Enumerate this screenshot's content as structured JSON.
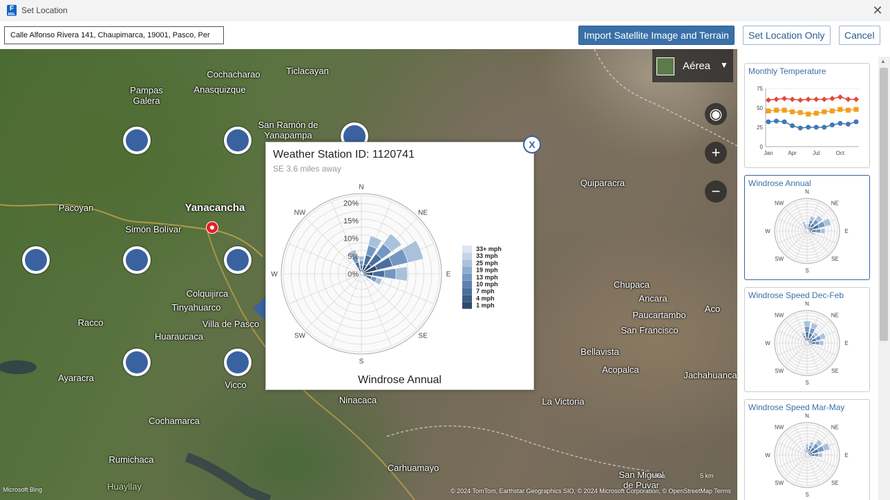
{
  "window": {
    "title": "Set Location",
    "app_icon_letter": "F",
    "app_icon_sub": "MSL",
    "close_symbol": "✕"
  },
  "toolbar": {
    "address_value": "Calle Alfonso Rivera 141, Chaupimarca, 19001, Pasco, Per",
    "import_label": "Import Satellite Image and Terrain",
    "set_location_label": "Set Location Only",
    "cancel_label": "Cancel"
  },
  "map": {
    "layer_label": "Aérea",
    "places": [
      {
        "name": "Cochacharao"
      },
      {
        "name": "Ticlacayan"
      },
      {
        "name": "Pampas\nGalera"
      },
      {
        "name": "Anasquizque"
      },
      {
        "name": "San Ramón de\nYanapampa"
      },
      {
        "name": "Pacoyan"
      },
      {
        "name": "Yanacancha"
      },
      {
        "name": "Simón Bolívar"
      },
      {
        "name": "Quiparacra"
      },
      {
        "name": "Colquijirca"
      },
      {
        "name": "Tinyahuarco"
      },
      {
        "name": "Villa de Pasco"
      },
      {
        "name": "Racco"
      },
      {
        "name": "Huaraucaca"
      },
      {
        "name": "Ayaracra"
      },
      {
        "name": "Vicco"
      },
      {
        "name": "Ninacaca"
      },
      {
        "name": "Cochamarca"
      },
      {
        "name": "Rumichaca"
      },
      {
        "name": "Huayllay"
      },
      {
        "name": "Carhuamayo"
      },
      {
        "name": "La Victoria"
      },
      {
        "name": "Chupaca"
      },
      {
        "name": "Ancara"
      },
      {
        "name": "Paucartambo"
      },
      {
        "name": "San Francisco"
      },
      {
        "name": "Aco"
      },
      {
        "name": "Bellavista"
      },
      {
        "name": "Acopalca"
      },
      {
        "name": "Jachahuanca"
      },
      {
        "name": "San Miguel\nde Puvar"
      }
    ],
    "bing_label": "Microsoft Bing",
    "copyright": "© 2024 TomTom, Earthstar Geographics SIO, © 2024 Microsoft Corporation, © OpenStreetMap Terms",
    "scale_miles": "millas",
    "scale_km": "5 km"
  },
  "popup": {
    "title": "Weather Station ID: 1120741",
    "subtitle": "SE 3.6 miles away",
    "caption": "Windrose Annual",
    "close_label": "X",
    "rose": {
      "directions": [
        "N",
        "NE",
        "E",
        "SE",
        "S",
        "SW",
        "W",
        "NW"
      ],
      "rings": [
        "0%",
        "5%",
        "10%",
        "15%",
        "20%"
      ],
      "legend": [
        "33+ mph",
        "33 mph",
        "25 mph",
        "19 mph",
        "13 mph",
        "10 mph",
        "7 mph",
        "4 mph",
        "1 mph"
      ],
      "legend_colors": [
        "#dbe6f1",
        "#c4d5e8",
        "#a9c2dc",
        "#8facd0",
        "#7497c2",
        "#5c82b2",
        "#4a6f9e",
        "#3b5c86",
        "#2e4a6d"
      ]
    }
  },
  "chart_data": [
    {
      "type": "line",
      "title": "Monthly Temperature",
      "x": [
        "Jan",
        "Feb",
        "Mar",
        "Apr",
        "May",
        "Jun",
        "Jul",
        "Aug",
        "Sep",
        "Oct",
        "Nov",
        "Dec"
      ],
      "xticks": [
        "Jan",
        "Apr",
        "Jul",
        "Oct"
      ],
      "ylim": [
        0,
        75
      ],
      "yticks": [
        0,
        25,
        50,
        75
      ],
      "series": [
        {
          "color": "#e0493c",
          "values": [
            60,
            61,
            62,
            61,
            60,
            61,
            61,
            61,
            62,
            64,
            61,
            61
          ]
        },
        {
          "color": "#f0a020",
          "values": [
            46,
            47,
            47,
            45,
            44,
            42,
            43,
            45,
            46,
            48,
            47,
            48
          ]
        },
        {
          "color": "#3f78b5",
          "values": [
            32,
            33,
            32,
            27,
            24,
            25,
            25,
            25,
            28,
            30,
            29,
            32
          ]
        }
      ]
    },
    {
      "type": "windrose",
      "title": "Windrose Annual",
      "directions": [
        "N",
        "NE",
        "E",
        "SE",
        "S",
        "SW",
        "W",
        "NW"
      ],
      "petals": [
        {
          "angle": 0,
          "value": 5
        },
        {
          "angle": 22.5,
          "value": 11
        },
        {
          "angle": 45,
          "value": 14
        },
        {
          "angle": 67.5,
          "value": 18
        },
        {
          "angle": 90,
          "value": 13
        },
        {
          "angle": 112.5,
          "value": 6
        },
        {
          "angle": 337.5,
          "value": 7
        }
      ]
    },
    {
      "type": "windrose",
      "title": "Windrose Speed Dec-Feb",
      "directions": [
        "N",
        "NE",
        "E",
        "SE",
        "S",
        "SW",
        "W",
        "NW"
      ],
      "petals": [
        {
          "angle": 0,
          "value": 16
        },
        {
          "angle": 22.5,
          "value": 15
        },
        {
          "angle": 45,
          "value": 10
        },
        {
          "angle": 67.5,
          "value": 14
        },
        {
          "angle": 90,
          "value": 12
        },
        {
          "angle": 112.5,
          "value": 5
        },
        {
          "angle": 337.5,
          "value": 8
        }
      ]
    },
    {
      "type": "windrose",
      "title": "Windrose Speed Mar-May",
      "directions": [
        "N",
        "NE",
        "E",
        "SE",
        "S",
        "SW",
        "W",
        "NW"
      ],
      "petals": [
        {
          "angle": 0,
          "value": 8
        },
        {
          "angle": 22.5,
          "value": 10
        },
        {
          "angle": 45,
          "value": 14
        },
        {
          "angle": 67.5,
          "value": 17
        },
        {
          "angle": 90,
          "value": 11
        },
        {
          "angle": 112.5,
          "value": 4
        },
        {
          "angle": 337.5,
          "value": 5
        }
      ]
    }
  ]
}
